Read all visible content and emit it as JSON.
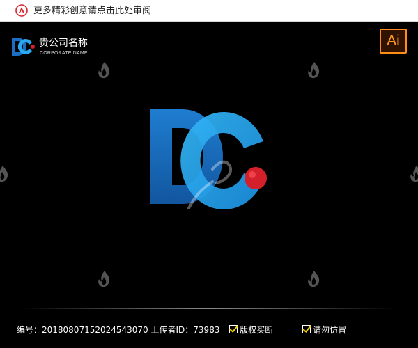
{
  "top_bar": {
    "promo_text": "更多精彩创意请点击此处审阅"
  },
  "app_badge": {
    "label": "Ai"
  },
  "brand": {
    "company_name": "贵公司名称",
    "company_sub": "CORPORATE NAME"
  },
  "main_logo": {
    "letters": "DC"
  },
  "footer": {
    "id_text": "编号：20180807152024543070 上传者ID：73983",
    "badge_1": "版权买断",
    "badge_2": "请勿仿冒"
  },
  "colors": {
    "background": "#000000",
    "logo_blue_dark": "#1a6fc4",
    "logo_blue_light": "#2aa8f0",
    "logo_dot_red": "#d4202a",
    "ai_badge_orange": "#ff8c1a",
    "check_yellow": "#f2d100"
  },
  "icons": {
    "alert": "alert-triangle-icon",
    "watermark": "watermark-flame-icon"
  }
}
